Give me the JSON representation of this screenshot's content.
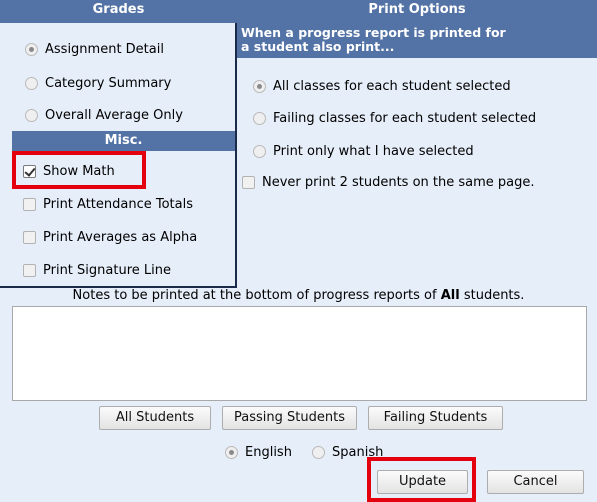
{
  "grades": {
    "header": "Grades",
    "options": [
      {
        "label": "Assignment Detail",
        "checked": true
      },
      {
        "label": "Category Summary",
        "checked": false
      },
      {
        "label": "Overall Average Only",
        "checked": false
      }
    ]
  },
  "misc": {
    "header": "Misc.",
    "options": [
      {
        "label": "Show Math",
        "checked": true
      },
      {
        "label": "Print Attendance Totals",
        "checked": false
      },
      {
        "label": "Print Averages as Alpha",
        "checked": false
      },
      {
        "label": "Print Signature Line",
        "checked": false
      }
    ]
  },
  "print_options": {
    "header": "Print Options",
    "subheader_line1": "When a progress report is printed for",
    "subheader_line2": "a student also print...",
    "options": [
      {
        "label": "All classes for each student selected",
        "checked": true
      },
      {
        "label": "Failing classes for each student selected",
        "checked": false
      },
      {
        "label": "Print only what I have selected",
        "checked": false
      }
    ],
    "never_print_label": "Never print 2 students on the same page.",
    "never_print_checked": false
  },
  "notes": {
    "label_prefix": "Notes to be printed at the bottom of progress reports of ",
    "label_bold": "All",
    "label_suffix": " students.",
    "value": ""
  },
  "student_buttons": {
    "all": "All Students",
    "passing": "Passing Students",
    "failing": "Failing Students"
  },
  "language": {
    "options": [
      {
        "label": "English",
        "checked": true
      },
      {
        "label": "Spanish",
        "checked": false
      }
    ]
  },
  "actions": {
    "update": "Update",
    "cancel": "Cancel"
  },
  "colors": {
    "header_bg": "#5372a6",
    "page_bg": "#e6eef9",
    "highlight": "#e4000f"
  }
}
